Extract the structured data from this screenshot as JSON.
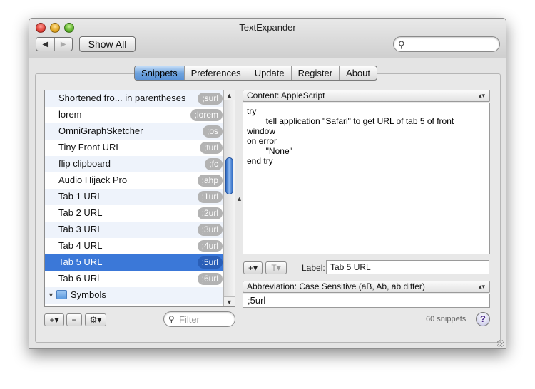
{
  "window": {
    "title": "TextExpander"
  },
  "toolbar": {
    "back_icon": "◀",
    "forward_icon": "▶",
    "show_all_label": "Show All",
    "search_value": ""
  },
  "tabs": [
    {
      "label": "Snippets",
      "active": true
    },
    {
      "label": "Preferences",
      "active": false
    },
    {
      "label": "Update",
      "active": false
    },
    {
      "label": "Register",
      "active": false
    },
    {
      "label": "About",
      "active": false
    }
  ],
  "snippets": [
    {
      "label": "Shortened fro... in parentheses",
      "abbr": ";surl"
    },
    {
      "label": "lorem",
      "abbr": ";lorem"
    },
    {
      "label": "OmniGraphSketcher",
      "abbr": ";os"
    },
    {
      "label": "Tiny Front URL",
      "abbr": ";turl"
    },
    {
      "label": "flip clipboard",
      "abbr": ";fc"
    },
    {
      "label": "Audio Hijack Pro",
      "abbr": ";ahp"
    },
    {
      "label": "Tab 1 URL",
      "abbr": ";1url"
    },
    {
      "label": "Tab 2 URL",
      "abbr": ";2url"
    },
    {
      "label": "Tab 3 URL",
      "abbr": ";3url"
    },
    {
      "label": "Tab 4 URL",
      "abbr": ";4url"
    },
    {
      "label": "Tab 5 URL",
      "abbr": ";5url",
      "selected": true
    },
    {
      "label": "Tab 6 URl",
      "abbr": ";6url"
    }
  ],
  "folder": {
    "label": "Symbols"
  },
  "list_controls": {
    "add_label": "+▾",
    "remove_label": "−",
    "gear_label": "⚙▾"
  },
  "filter": {
    "placeholder": "Filter"
  },
  "content": {
    "type_label": "Content: AppleScript",
    "lines": [
      "try",
      "        tell application \"Safari\" to get URL of tab 5 of front",
      "window",
      "on error",
      "        \"None\"",
      "end try"
    ]
  },
  "editor_controls": {
    "add_label": "+▾",
    "text_label": "T▾"
  },
  "label_field": {
    "caption": "Label:",
    "value": "Tab 5 URL"
  },
  "abbreviation": {
    "mode_label": "Abbreviation: Case Sensitive (aB, Ab, ab differ)",
    "value": ";5url"
  },
  "status": {
    "count_label": "60 snippets",
    "help_label": "?"
  },
  "colors": {
    "selection": "#3b78d8",
    "active_tab": "#6fa3dd",
    "pill": "#b3b3b3"
  }
}
